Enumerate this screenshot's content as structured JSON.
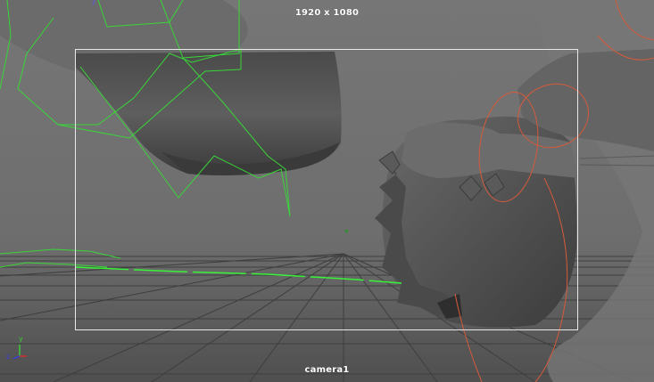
{
  "viewport": {
    "resolution_label": "1920 x 1080",
    "camera_label": "camera1",
    "axis_labels": {
      "x": "x",
      "y": "y",
      "z": "z"
    },
    "top_axis_label": "z"
  },
  "colors": {
    "background": "#6e6e6e",
    "gate_border": "#e8e8e8",
    "wireframe_green": "#39d639",
    "curve_red": "#d45a3c",
    "axis_x": "#d03030",
    "axis_y": "#3cc83c",
    "axis_z": "#3c3cd8"
  },
  "icons": [
    "axis-gizmo-icon"
  ]
}
